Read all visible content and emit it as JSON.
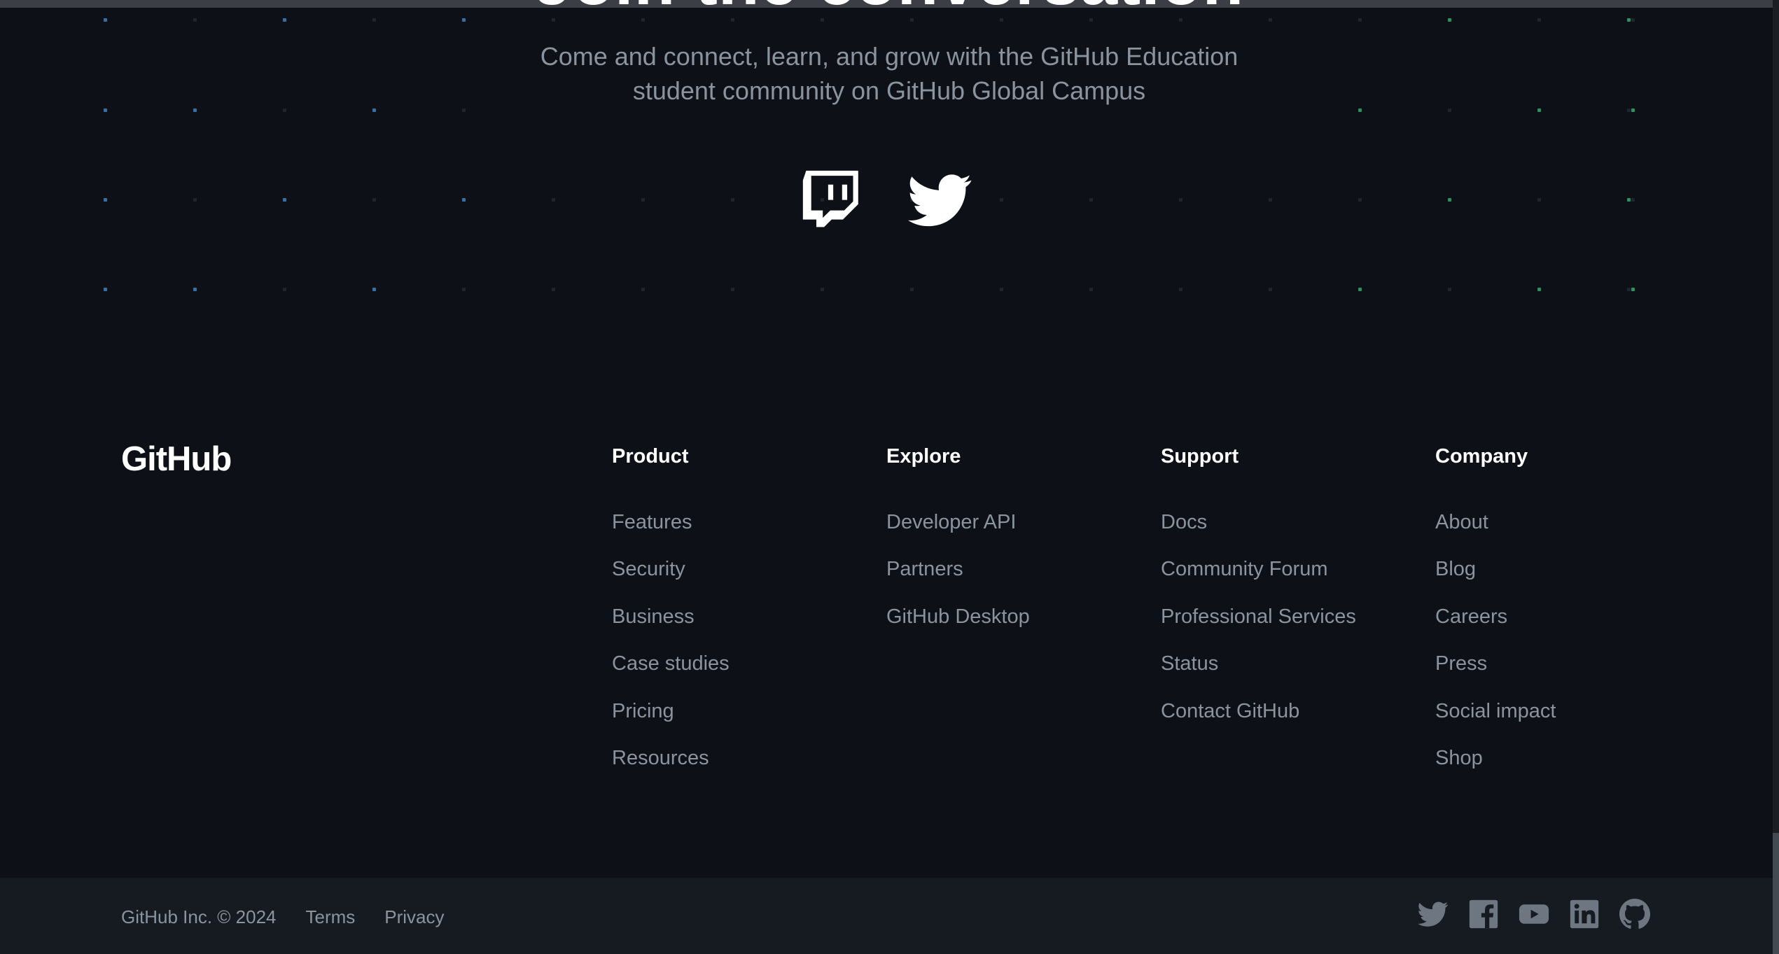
{
  "hero": {
    "heading": "Join the conversation",
    "subtitle_line1": "Come and connect, learn, and grow with the GitHub Education",
    "subtitle_line2": "student community on GitHub Global Campus"
  },
  "social_center": [
    {
      "icon": "twitch-icon"
    },
    {
      "icon": "twitter-icon"
    }
  ],
  "footer": {
    "logo": "GitHub",
    "columns": [
      {
        "title": "Product",
        "links": [
          "Features",
          "Security",
          "Business",
          "Case studies",
          "Pricing",
          "Resources"
        ]
      },
      {
        "title": "Explore",
        "links": [
          "Developer API",
          "Partners",
          "GitHub Desktop"
        ]
      },
      {
        "title": "Support",
        "links": [
          "Docs",
          "Community Forum",
          "Professional Services",
          "Status",
          "Contact GitHub"
        ]
      },
      {
        "title": "Company",
        "links": [
          "About",
          "Blog",
          "Careers",
          "Press",
          "Social impact",
          "Shop"
        ]
      }
    ],
    "copyright": "GitHub Inc. © 2024",
    "bottom_links": [
      "Terms",
      "Privacy"
    ],
    "bottom_icons": [
      "twitter-icon",
      "facebook-icon",
      "youtube-icon",
      "linkedin-icon",
      "github-icon"
    ]
  },
  "colors": {
    "background": "#0d1117",
    "footer_bar": "#161b22",
    "muted_text": "#8b949e",
    "heading_text": "#ffffff",
    "footer_icon": "#6e7681",
    "dot_blue": "#3b6f9e",
    "dot_green": "#2f8f5f"
  }
}
